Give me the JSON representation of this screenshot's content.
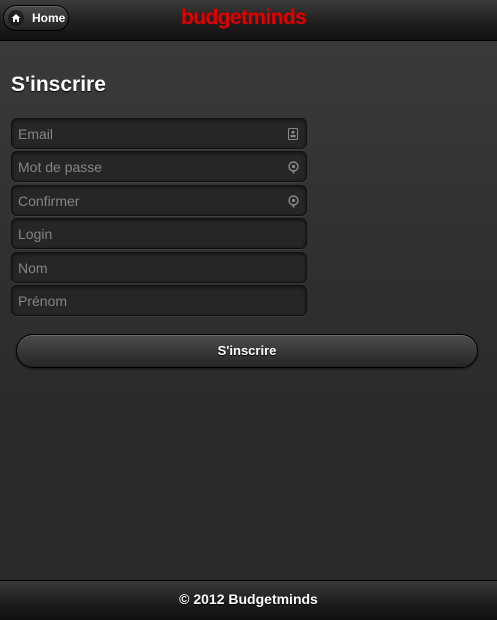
{
  "header": {
    "home_label": "Home",
    "home_icon": "home-icon",
    "logo_text": "budgetminds",
    "logo_color": "#e00000"
  },
  "page": {
    "title": "S'inscrire"
  },
  "form": {
    "fields": [
      {
        "placeholder": "Email",
        "value": "",
        "icon": "contact-card-icon"
      },
      {
        "placeholder": "Mot de passe",
        "value": "",
        "icon": "lock-icon"
      },
      {
        "placeholder": "Confirmer",
        "value": "",
        "icon": "lock-icon"
      },
      {
        "placeholder": "Login",
        "value": ""
      },
      {
        "placeholder": "Nom",
        "value": ""
      },
      {
        "placeholder": "Prénom",
        "value": ""
      }
    ],
    "submit_label": "S'inscrire"
  },
  "footer": {
    "text": "© 2012 Budgetminds"
  }
}
